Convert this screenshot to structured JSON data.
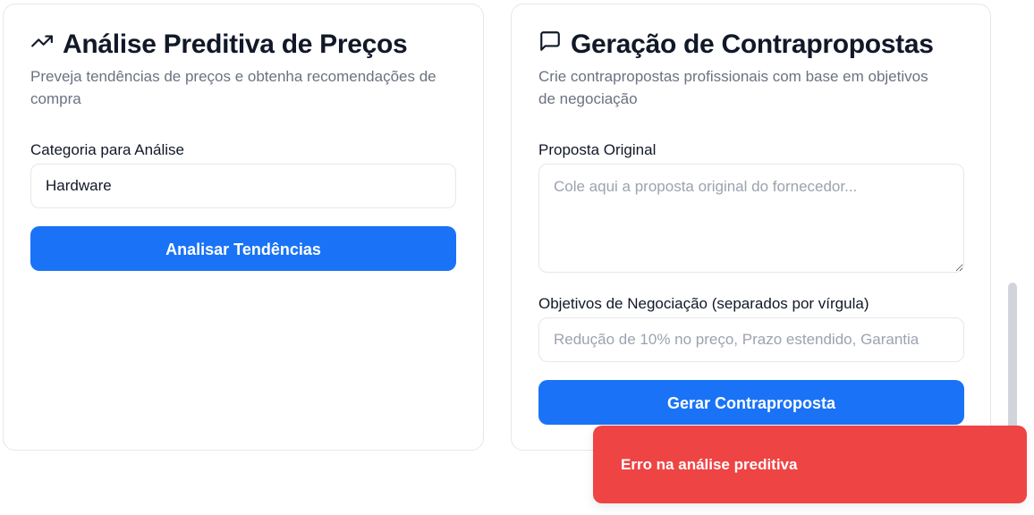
{
  "predictive": {
    "icon": "trending-up-icon",
    "title": "Análise Preditiva de Preços",
    "description": "Preveja tendências de preços e obtenha recomendações de compra",
    "category_label": "Categoria para Análise",
    "category_value": "Hardware",
    "analyze_button": "Analisar Tendências"
  },
  "counter": {
    "icon": "message-square-icon",
    "title": "Geração de Contrapropostas",
    "description": "Crie contrapropostas profissionais com base em objetivos de negociação",
    "proposal_label": "Proposta Original",
    "proposal_placeholder": "Cole aqui a proposta original do fornecedor...",
    "objectives_label": "Objetivos de Negociação (separados por vírgula)",
    "objectives_placeholder": "Redução de 10% no preço, Prazo estendido, Garantia",
    "generate_button": "Gerar Contraproposta"
  },
  "toast": {
    "message": "Erro na análise preditiva",
    "color": "#ef4444"
  },
  "colors": {
    "primary": "#1a73f6",
    "muted_text": "#6b7280"
  }
}
